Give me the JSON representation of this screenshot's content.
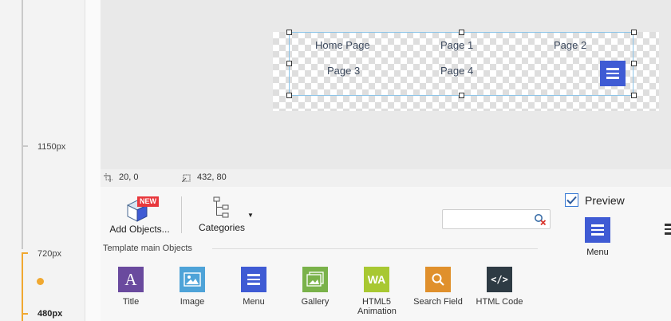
{
  "ruler": {
    "bp_1150": "1150px",
    "bp_720": "720px",
    "bp_480": "480px"
  },
  "canvas": {
    "menu_items": [
      "Home Page",
      "Page 1",
      "Page 2",
      "Page 3",
      "Page 4"
    ]
  },
  "status": {
    "position": "20, 0",
    "size": "432, 80"
  },
  "toolbar": {
    "add_objects_label": "Add Objects...",
    "new_badge": "NEW",
    "categories_label": "Categories",
    "search_placeholder": ""
  },
  "panel": {
    "section_title": "Template main Objects",
    "preview_label": "Preview",
    "preview_checked": true,
    "selected_object_label": "Menu",
    "objects": [
      {
        "label": "Title",
        "icon": "title-a-icon",
        "color": "#6a4a9e"
      },
      {
        "label": "Image",
        "icon": "image-icon",
        "color": "#4ea3d8"
      },
      {
        "label": "Menu",
        "icon": "hamburger-icon",
        "color": "#3f5bd4"
      },
      {
        "label": "Gallery",
        "icon": "gallery-icon",
        "color": "#7ab24a"
      },
      {
        "label": "HTML5 Animation",
        "icon": "wa-icon",
        "color": "#a8c832"
      },
      {
        "label": "Search Field",
        "icon": "magnifier-icon",
        "color": "#e0902c"
      },
      {
        "label": "HTML Code",
        "icon": "code-icon",
        "color": "#2e3b44"
      }
    ]
  },
  "colors": {
    "accent_blue": "#3f5bd4",
    "breakpoint_orange": "#f0a830",
    "new_badge_red": "#e8383d",
    "selection_blue": "#8cc4e8"
  }
}
